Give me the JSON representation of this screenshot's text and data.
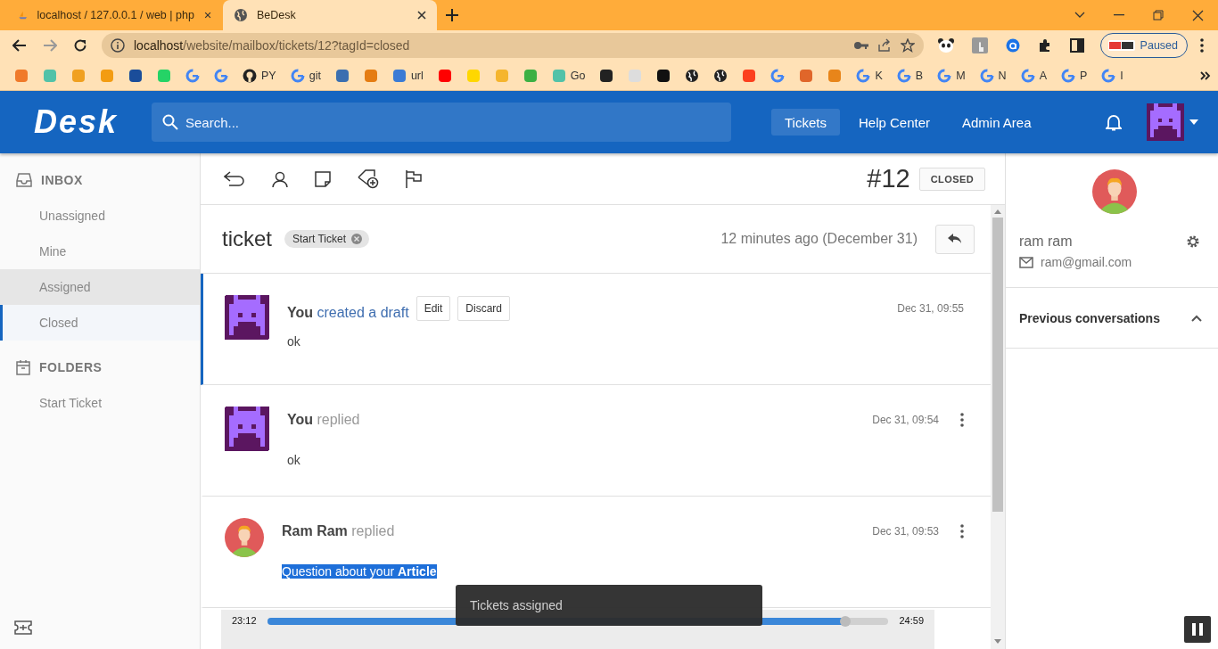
{
  "browser": {
    "tabs": [
      {
        "title": "localhost / 127.0.0.1 / web | php",
        "selected": false,
        "kind": "pma"
      },
      {
        "title": "BeDesk",
        "selected": true,
        "kind": "globe"
      }
    ],
    "url": {
      "host": "localhost",
      "path": "/website/mailbox/tickets/12?tagId=closed"
    },
    "profile": {
      "status": "Paused"
    },
    "bookmarks": [
      {
        "kind": "site",
        "color": "#f07a2a"
      },
      {
        "kind": "site",
        "color": "#52c2a8"
      },
      {
        "kind": "site",
        "color": "#f0a020"
      },
      {
        "kind": "site",
        "color": "#f39c12"
      },
      {
        "kind": "site",
        "color": "#1a4d9a"
      },
      {
        "kind": "site",
        "color": "#25d366"
      },
      {
        "kind": "google"
      },
      {
        "kind": "google"
      },
      {
        "kind": "github",
        "label": "PY"
      },
      {
        "kind": "google",
        "label": "git"
      },
      {
        "kind": "site",
        "color": "#3b6fb0"
      },
      {
        "kind": "site",
        "color": "#e57c12"
      },
      {
        "kind": "site",
        "color": "#3a7bd5",
        "label": "url"
      },
      {
        "kind": "site",
        "color": "#ff0000"
      },
      {
        "kind": "site",
        "color": "#ffd700"
      },
      {
        "kind": "site",
        "color": "#f5b52e"
      },
      {
        "kind": "site",
        "color": "#3cb043"
      },
      {
        "kind": "site",
        "color": "#52c2a8",
        "label": "Go"
      },
      {
        "kind": "site",
        "color": "#222222"
      },
      {
        "kind": "site",
        "color": "#dddddd"
      },
      {
        "kind": "site",
        "color": "#111111"
      },
      {
        "kind": "globe"
      },
      {
        "kind": "globe"
      },
      {
        "kind": "site",
        "color": "#fc3f1d"
      },
      {
        "kind": "google"
      },
      {
        "kind": "site",
        "color": "#e0662a"
      },
      {
        "kind": "site",
        "color": "#e8851a"
      },
      {
        "kind": "google",
        "label": "K"
      },
      {
        "kind": "google",
        "label": "B"
      },
      {
        "kind": "google",
        "label": "M"
      },
      {
        "kind": "google",
        "label": "N"
      },
      {
        "kind": "google",
        "label": "A"
      },
      {
        "kind": "google",
        "label": "P"
      },
      {
        "kind": "google",
        "label": "I"
      }
    ]
  },
  "header": {
    "logo": "Desk",
    "search": {
      "placeholder": "Search..."
    },
    "nav": [
      {
        "label": "Tickets",
        "selected": true
      },
      {
        "label": "Help Center",
        "selected": false
      },
      {
        "label": "Admin Area",
        "selected": false
      }
    ]
  },
  "sidebar": {
    "sections": [
      {
        "title": "INBOX",
        "kind": "inbox",
        "items": [
          {
            "label": "Unassigned",
            "selected": false,
            "hovered": false
          },
          {
            "label": "Mine",
            "selected": false,
            "hovered": false
          },
          {
            "label": "Assigned",
            "selected": false,
            "hovered": true
          },
          {
            "label": "Closed",
            "selected": true,
            "hovered": false
          }
        ]
      },
      {
        "title": "FOLDERS",
        "kind": "folder",
        "items": [
          {
            "label": "Start Ticket",
            "selected": false,
            "hovered": false
          }
        ]
      }
    ]
  },
  "ticket": {
    "number": "#12",
    "status": "CLOSED",
    "subject": "ticket",
    "tag": "Start Ticket",
    "time": "12 minutes ago (December 31)",
    "threads": [
      {
        "kind": "draft",
        "avatar": {
          "kind": "pixel"
        },
        "author": "You",
        "action": "created a draft",
        "buttons": [
          "Edit",
          "Discard"
        ],
        "time": "Dec 31, 09:55",
        "body": "ok",
        "highlighted": false
      },
      {
        "kind": "reply",
        "avatar": {
          "kind": "pixel"
        },
        "author": "You",
        "action": "replied",
        "time": "Dec 31, 09:54",
        "body": "ok",
        "highlighted": false
      },
      {
        "kind": "reply",
        "avatar": {
          "kind": "person"
        },
        "author": "Ram Ram",
        "action": "replied",
        "time": "Dec 31, 09:53",
        "body": "Question about your **Article**",
        "highlighted": true
      }
    ]
  },
  "customer": {
    "name": "ram ram",
    "email": "ram@gmail.com",
    "sections": [
      {
        "title": "Previous conversations",
        "expanded": true
      }
    ]
  },
  "player": {
    "elapsed": "23:12",
    "duration": "24:59",
    "level": 0.93
  },
  "toast": {
    "text": "Tickets assigned"
  }
}
